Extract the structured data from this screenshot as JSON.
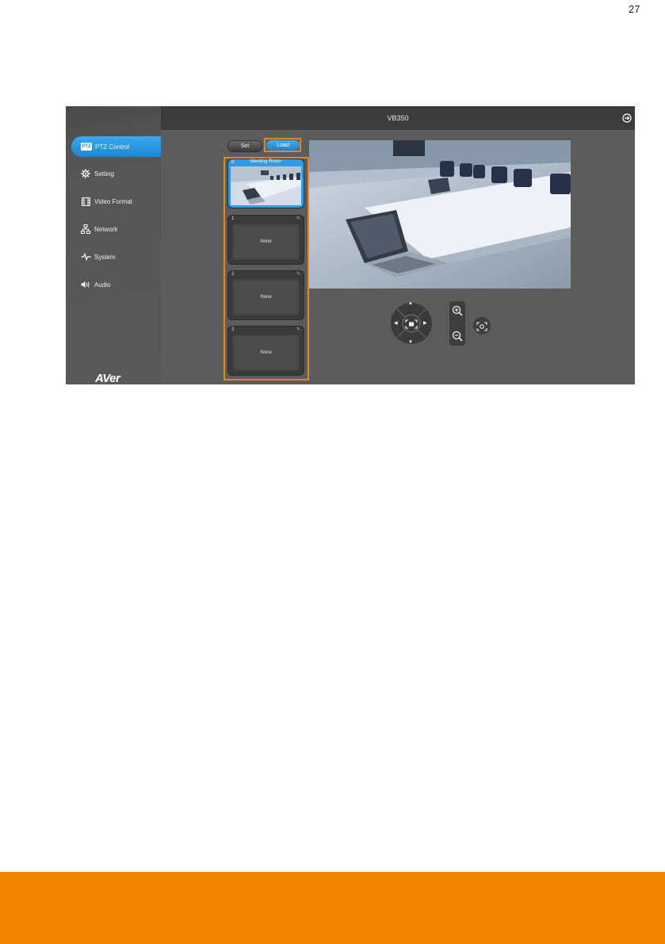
{
  "page_number": "27",
  "app": {
    "title": "VB350",
    "logo": "AVer",
    "sidebar": {
      "items": [
        {
          "label": "PTZ Control",
          "icon": "ptz-icon",
          "icon_text": "PTZ",
          "active": true
        },
        {
          "label": "Setting",
          "icon": "gear-icon"
        },
        {
          "label": "Video Format",
          "icon": "film-icon"
        },
        {
          "label": "Network",
          "icon": "network-icon"
        },
        {
          "label": "System",
          "icon": "pulse-icon"
        },
        {
          "label": "Audio",
          "icon": "speaker-icon"
        }
      ]
    },
    "toolbar": {
      "set_label": "Set",
      "load_label": "Load"
    },
    "presets": [
      {
        "number": "0",
        "name": "Meeting Room",
        "active": true
      },
      {
        "number": "1",
        "name": "None"
      },
      {
        "number": "2",
        "name": "None"
      },
      {
        "number": "3",
        "name": "None"
      }
    ],
    "colors": {
      "accent": "#1d86d6",
      "highlight": "#e8851c",
      "footer": "#ef8200"
    }
  }
}
